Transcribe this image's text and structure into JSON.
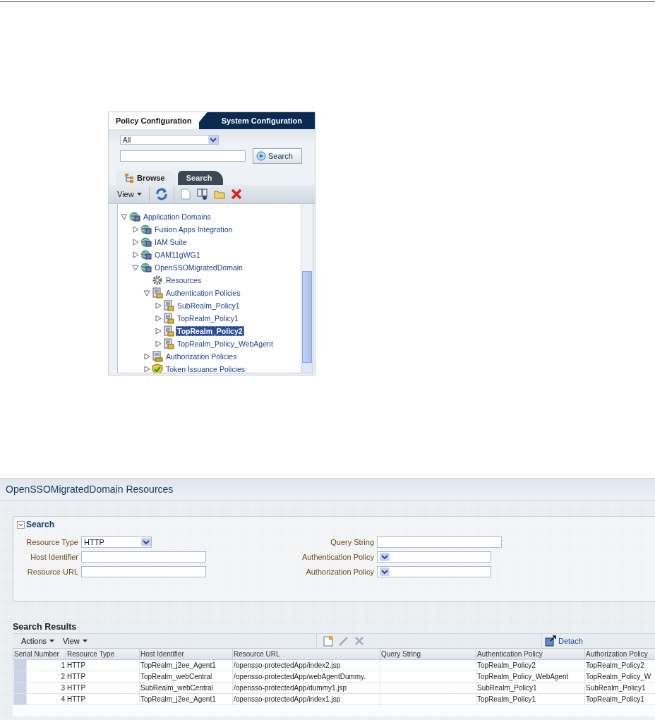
{
  "policy_panel": {
    "tabs": [
      {
        "label": "Policy Configuration",
        "selected": true
      },
      {
        "label": "System Configuration",
        "selected": false
      }
    ],
    "scope_select": {
      "value": "All"
    },
    "search_button": "Search",
    "browse_tabs": [
      {
        "label": "Browse",
        "selected": true
      },
      {
        "label": "Search",
        "selected": false
      }
    ],
    "view_menu": "View",
    "tree": [
      {
        "label": "Application Domains",
        "kind": "domain",
        "expanded": true,
        "selected": false,
        "children": [
          {
            "label": "Fusion Apps Integration",
            "kind": "domain",
            "expanded": false,
            "selected": false
          },
          {
            "label": "IAM Suite",
            "kind": "domain",
            "expanded": false,
            "selected": false
          },
          {
            "label": "OAM11gWG1",
            "kind": "domain",
            "expanded": false,
            "selected": false
          },
          {
            "label": "OpenSSOMigratedDomain",
            "kind": "domain",
            "expanded": true,
            "selected": false,
            "children": [
              {
                "label": "Resources",
                "kind": "resources",
                "selected": false
              },
              {
                "label": "Authentication Policies",
                "kind": "policy-set",
                "expanded": true,
                "selected": false,
                "children": [
                  {
                    "label": "SubRealm_Policy1",
                    "kind": "policy",
                    "expanded": false,
                    "selected": false
                  },
                  {
                    "label": "TopRealm_Policy1",
                    "kind": "policy",
                    "expanded": false,
                    "selected": false
                  },
                  {
                    "label": "TopRealm_Policy2",
                    "kind": "policy",
                    "expanded": false,
                    "selected": true
                  },
                  {
                    "label": "TopRealm_Policy_WebAgent",
                    "kind": "policy",
                    "expanded": false,
                    "selected": false
                  }
                ]
              },
              {
                "label": "Authorization Policies",
                "kind": "authorization",
                "expanded": false,
                "selected": false
              },
              {
                "label": "Token Issuance Policies",
                "kind": "token",
                "expanded": false,
                "selected": false
              }
            ]
          }
        ]
      }
    ]
  },
  "resources_panel": {
    "title": "OpenSSOMigratedDomain Resources",
    "search": {
      "label": "Search",
      "expanded": true,
      "left_fields": [
        {
          "label": "Resource Type",
          "kind": "select",
          "value": "HTTP"
        },
        {
          "label": "Host Identifier",
          "kind": "text"
        },
        {
          "label": "Resource URL",
          "kind": "text"
        }
      ],
      "right_fields": [
        {
          "label": "Query String",
          "kind": "text"
        },
        {
          "label": "Authentication Policy",
          "kind": "select"
        },
        {
          "label": "Authorization Policy",
          "kind": "select"
        }
      ]
    },
    "results": {
      "title": "Search Results",
      "menus": [
        "Actions",
        "View"
      ],
      "detach": "Detach",
      "columns": [
        "Serial Number",
        "Resource Type",
        "Host Identifier",
        "Resource URL",
        "Query String",
        "Authentication Policy",
        "Authorization Policy"
      ],
      "rows": [
        [
          "1",
          "HTTP",
          "TopRealm_j2ee_Agent1",
          "/opensso-protectedApp/index2.jsp",
          "",
          "TopRealm_Policy2",
          "TopRealm_Policy2"
        ],
        [
          "2",
          "HTTP",
          "TopRealm_webCentral",
          "/opensso-protectedApp/webAgentDummy.",
          "",
          "TopRealm_Policy_WebAgent",
          "TopRealm_Policy_W"
        ],
        [
          "3",
          "HTTP",
          "SubRealm_webCentral",
          "/opensso-protectedApp/dummy1.jsp",
          "",
          "SubRealm_Policy1",
          "SubRealm_Policy1"
        ],
        [
          "4",
          "HTTP",
          "TopRealm_j2ee_Agent1",
          "/opensso-protectedApp/index1.jsp",
          "",
          "TopRealm_Policy1",
          "TopRealm_Policy1"
        ]
      ]
    }
  }
}
